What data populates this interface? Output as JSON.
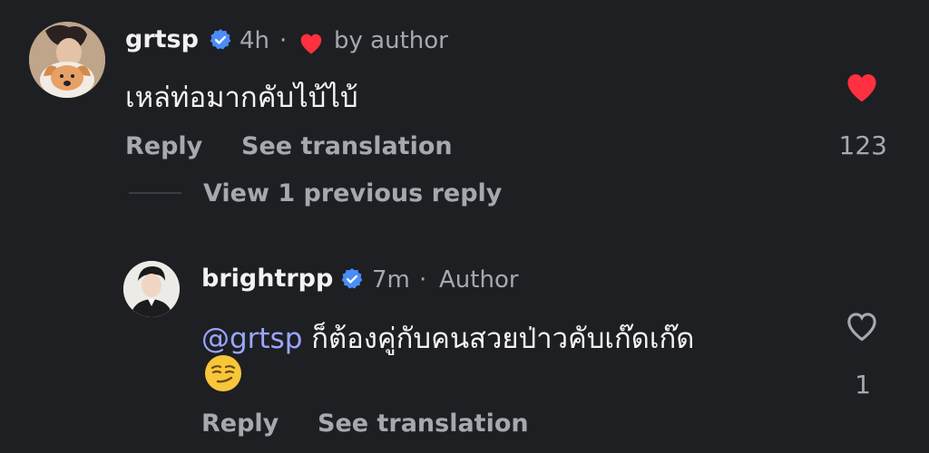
{
  "comment": {
    "username": "grtsp",
    "time": "4h",
    "separator": "·",
    "liked_by_label": "by author",
    "text": "เหล่ท่อมากคับไบ้ไบ้",
    "reply_label": "Reply",
    "translate_label": "See translation",
    "like_count": "123",
    "liked": true,
    "icons": {
      "verified": "verified-badge-icon",
      "like": "heart-filled-icon",
      "liked_by_author": "heart-icon"
    }
  },
  "replies_toggle": {
    "label": "View 1 previous reply"
  },
  "reply": {
    "username": "brightrpp",
    "time": "7m",
    "separator": "·",
    "role_label": "Author",
    "mention": "@grtsp",
    "text": "ก็ต้องคู่กับคนสวยป่าวคับเก๊ดเก๊ด",
    "emoji": "smirking-face-emoji",
    "reply_label": "Reply",
    "translate_label": "See translation",
    "like_count": "1",
    "liked": false,
    "icons": {
      "verified": "verified-badge-icon",
      "like": "heart-outline-icon"
    }
  },
  "colors": {
    "background": "#1e1f23",
    "verified": "#4a8df8",
    "like_red": "#ff3040",
    "mention": "#9aa6ff",
    "secondary_text": "#a6a8ad"
  }
}
